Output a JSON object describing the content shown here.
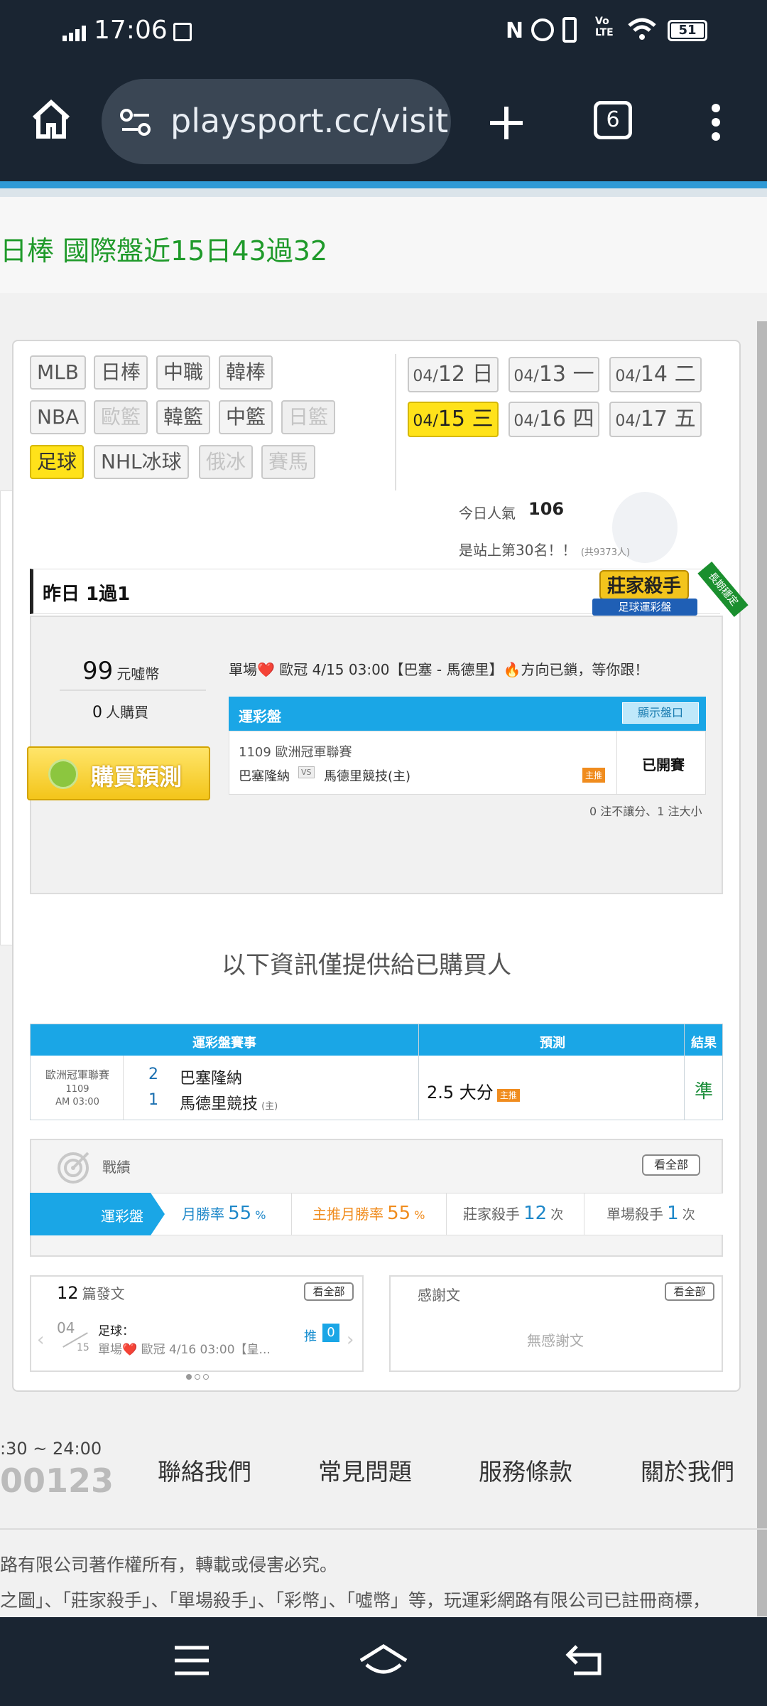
{
  "status_bar": {
    "time": "17:06",
    "battery": "51",
    "volte": "Vo LTE"
  },
  "browser": {
    "url": "playsport.cc/visit",
    "tab_count": "6"
  },
  "headline": "日棒 國際盤近15日43過32",
  "sports": [
    {
      "label": "MLB",
      "state": "normal"
    },
    {
      "label": "日棒",
      "state": "normal"
    },
    {
      "label": "中職",
      "state": "normal"
    },
    {
      "label": "韓棒",
      "state": "normal"
    },
    {
      "label": "NBA",
      "state": "normal"
    },
    {
      "label": "歐籃",
      "state": "disabled"
    },
    {
      "label": "韓籃",
      "state": "normal"
    },
    {
      "label": "中籃",
      "state": "normal"
    },
    {
      "label": "日籃",
      "state": "disabled"
    },
    {
      "label": "足球",
      "state": "active"
    },
    {
      "label": "NHL冰球",
      "state": "normal"
    },
    {
      "label": "俄冰",
      "state": "disabled"
    },
    {
      "label": "賽馬",
      "state": "disabled"
    }
  ],
  "dates": [
    {
      "md_small": "04/",
      "day": "12",
      "week": "日",
      "state": "normal"
    },
    {
      "md_small": "04/",
      "day": "13",
      "week": "一",
      "state": "normal"
    },
    {
      "md_small": "04/",
      "day": "14",
      "week": "二",
      "state": "normal"
    },
    {
      "md_small": "04/",
      "day": "15",
      "week": "三",
      "state": "active"
    },
    {
      "md_small": "04/",
      "day": "16",
      "week": "四",
      "state": "normal"
    },
    {
      "md_small": "04/",
      "day": "17",
      "week": "五",
      "state": "normal"
    }
  ],
  "popularity": {
    "label": "今日人氣",
    "value": "106",
    "rank_text": "是站上第30名！！",
    "rank_note": "(共9373人)"
  },
  "yesterday": "昨日 1過1",
  "badge": {
    "title": "莊家殺手",
    "subtitle": "足球運彩盤",
    "ribbon": "長期穩定"
  },
  "price": {
    "value": "99",
    "unit": "元噓幣",
    "buyers_count": "0",
    "buyers_label": "人購買",
    "buy_button": "購買預測"
  },
  "promo_text": "單場❤️ 歐冠 4/15 03:00【巴塞 - 馬德里】🔥方向已鎖，等你跟！",
  "lottery_box": {
    "title": "運彩盤",
    "show_button": "顯示盤口",
    "game_no_league": "1109 歐洲冠軍聯賽",
    "team_a": "巴塞隆納",
    "vs": "VS",
    "team_b": "馬德里競技(主)",
    "tag": "主推",
    "status": "已開賽",
    "note": "0 注不讓分、1 注大小"
  },
  "info_notice": "以下資訊僅提供給已購買人",
  "result_table": {
    "headers": [
      "運彩盤賽事",
      "預測",
      "結果"
    ],
    "league": "歐洲冠軍聯賽",
    "game_no": "1109",
    "time": "AM 03:00",
    "score_a": "2",
    "team_a": "巴塞隆納",
    "score_b": "1",
    "team_b": "馬德里競技",
    "home_tag": "(主)",
    "prediction": "2.5 大分",
    "pred_tag": "主推",
    "result": "準"
  },
  "record": {
    "title": "戰績",
    "view_all": "看全部",
    "tab_label": "運彩盤",
    "month_win_label": "月勝率",
    "month_win_value": "55",
    "month_win_unit": "%",
    "main_month_label": "主推月勝率",
    "main_month_value": "55",
    "main_month_unit": "%",
    "killer_label": "莊家殺手",
    "killer_value": "12",
    "killer_unit": "次",
    "single_label": "單場殺手",
    "single_value": "1",
    "single_unit": "次"
  },
  "articles": {
    "count": "12",
    "label": "篇發文",
    "view_all": "看全部",
    "date_month": "04",
    "date_day": "15",
    "cat": "足球：",
    "snippet": "單場❤️ 歐冠 4/16 03:00【皇...",
    "push_label": "推",
    "push_count": "0"
  },
  "thanks": {
    "title": "感謝文",
    "view_all": "看全部",
    "empty": "無感謝文"
  },
  "footer": {
    "hours": ":30 ~ 24:00",
    "phone": "00123",
    "links": [
      "聯絡我們",
      "常見問題",
      "服務條款",
      "關於我們"
    ],
    "copyright": "路有限公司著作權所有，轉載或侵害必究。",
    "trademark": "之圖」、「莊家殺手」、「單場殺手」、「彩幣」、「噓幣」等，玩運彩網路有限公司已註冊商標，"
  }
}
